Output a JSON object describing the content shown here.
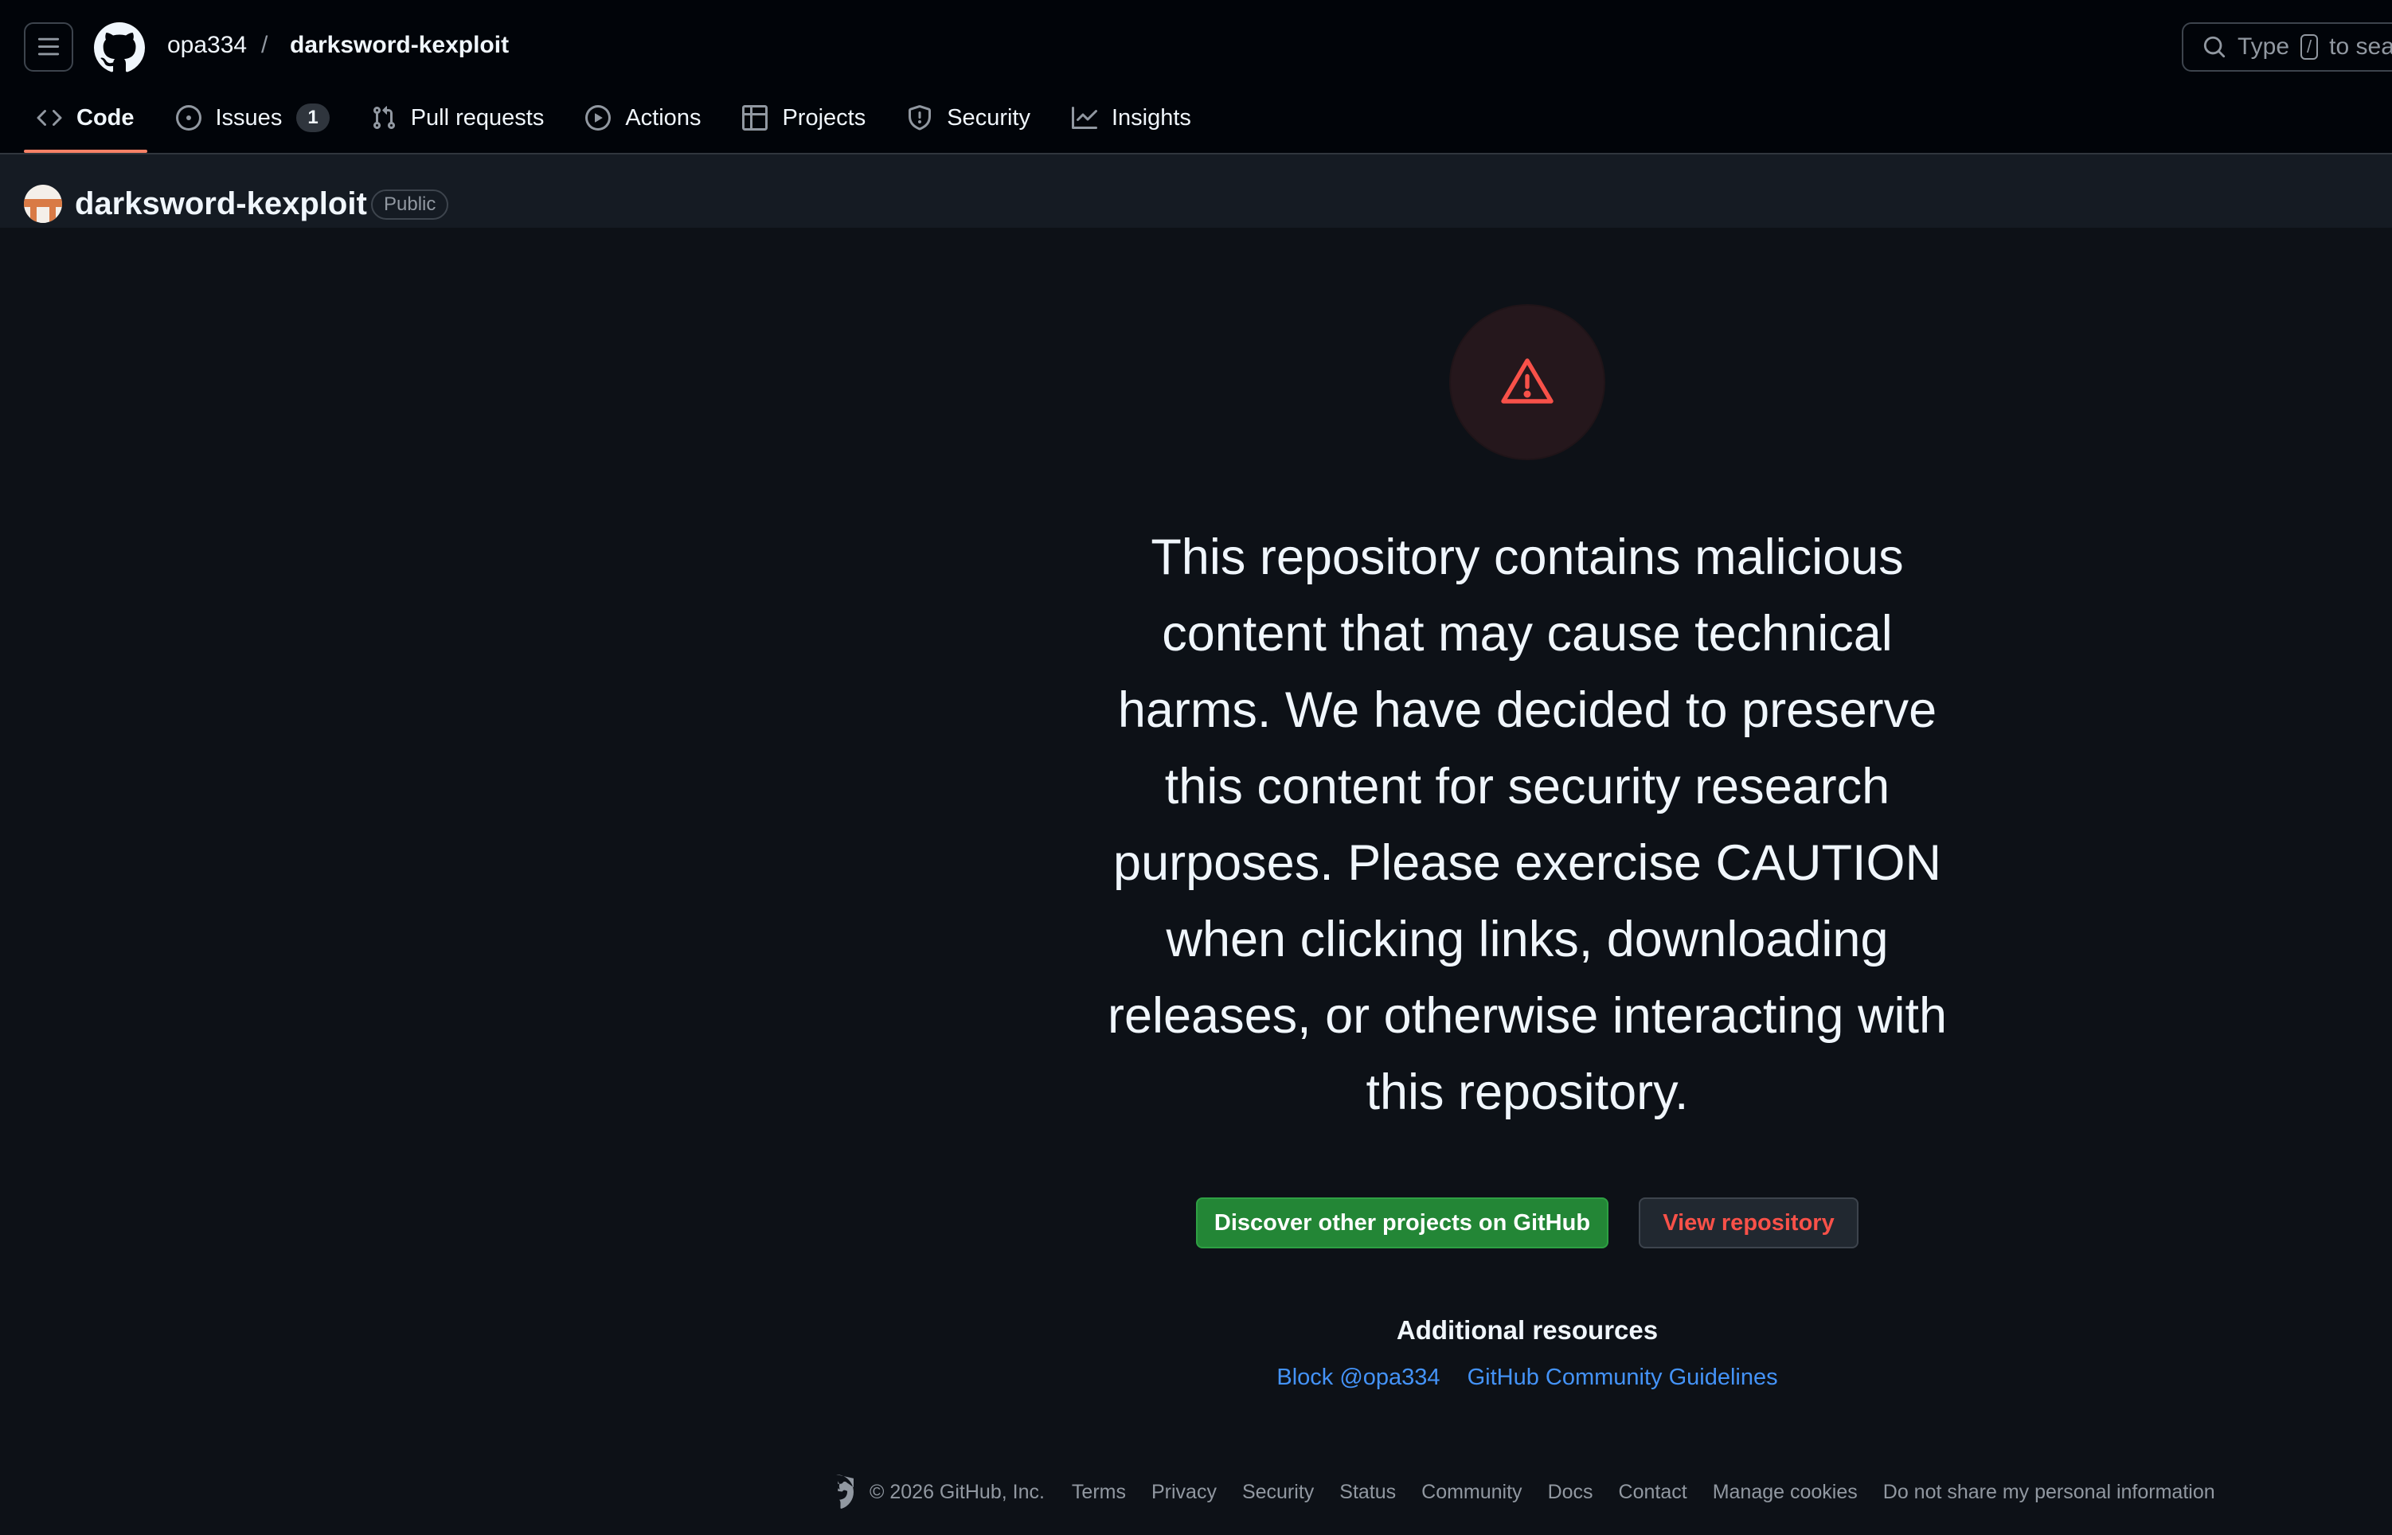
{
  "header": {
    "owner": "opa334",
    "separator": "/",
    "repo": "darksword-kexploit",
    "search_prefix": "Type",
    "search_key": "/",
    "search_suffix": "to search"
  },
  "nav": {
    "code": "Code",
    "issues": "Issues",
    "issues_count": "1",
    "pull_requests": "Pull requests",
    "actions": "Actions",
    "projects": "Projects",
    "security": "Security",
    "insights": "Insights"
  },
  "repo_bar": {
    "title": "darksword-kexploit",
    "visibility": "Public"
  },
  "warning": {
    "message": "This repository contains malicious content that may cause technical harms. We have decided to preserve this content for security research purposes. Please exercise CAUTION when clicking links, downloading releases, or otherwise interacting with this repository.",
    "discover_button": "Discover other projects on GitHub",
    "view_button": "View repository"
  },
  "resources": {
    "title": "Additional resources",
    "block_link": "Block @opa334",
    "guidelines_link": "GitHub Community Guidelines"
  },
  "footer": {
    "copyright": "© 2026 GitHub, Inc.",
    "links": [
      "Terms",
      "Privacy",
      "Security",
      "Status",
      "Community",
      "Docs",
      "Contact",
      "Manage cookies",
      "Do not share my personal information"
    ]
  },
  "colors": {
    "page_bg": "#0d1117",
    "header_bg": "#010409",
    "accent_tab": "#f78166",
    "green_button": "#238636",
    "danger_text": "#f85149",
    "link": "#4493f8"
  }
}
